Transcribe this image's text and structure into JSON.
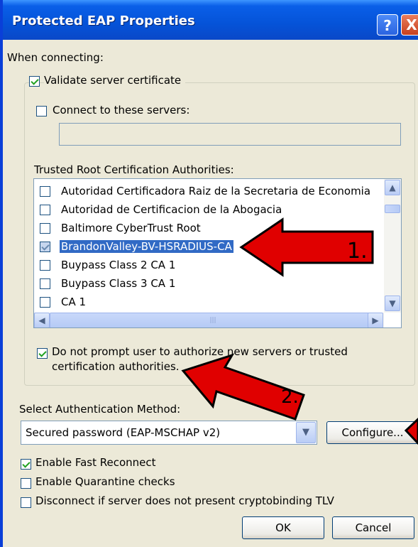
{
  "window": {
    "title": "Protected EAP Properties",
    "help_label": "?",
    "close_label": "X"
  },
  "when_connecting_label": "When connecting:",
  "validate_cert": {
    "label": "Validate server certificate",
    "checked": true
  },
  "connect_servers": {
    "label": "Connect to these servers:",
    "checked": false,
    "value": ""
  },
  "trusted_label": "Trusted Root Certification Authorities:",
  "ca_list": [
    {
      "label": "Autoridad Certificadora Raiz de la Secretaria de Economia",
      "checked": false
    },
    {
      "label": "Autoridad de Certificacion de la Abogacia",
      "checked": false
    },
    {
      "label": "Baltimore CyberTrust Root",
      "checked": false
    },
    {
      "label": "BrandonValley-BV-HSRADIUS-CA",
      "checked": true,
      "selected": true
    },
    {
      "label": "Buypass Class 2 CA 1",
      "checked": false
    },
    {
      "label": "Buypass Class 3 CA 1",
      "checked": false
    },
    {
      "label": "CA 1",
      "checked": false
    }
  ],
  "no_prompt": {
    "label_line1": "Do not prompt user to authorize new servers or trusted",
    "label_line2": "certification authorities.",
    "checked": true
  },
  "auth_method_label": "Select Authentication Method:",
  "auth_method_value": "Secured password (EAP-MSCHAP v2)",
  "configure_label": "Configure...",
  "fast_reconnect": {
    "label": "Enable Fast Reconnect",
    "checked": true
  },
  "quarantine": {
    "label": "Enable Quarantine checks",
    "checked": false
  },
  "cryptobinding": {
    "label": "Disconnect if server does not present cryptobinding TLV",
    "checked": false
  },
  "ok_label": "OK",
  "cancel_label": "Cancel",
  "annotations": {
    "arrow1": "1.",
    "arrow2": "2."
  },
  "colors": {
    "titlebar": "#0553D8",
    "dialog_bg": "#ECE9D8",
    "selection": "#316AC5",
    "arrow_fill": "#E00000"
  }
}
